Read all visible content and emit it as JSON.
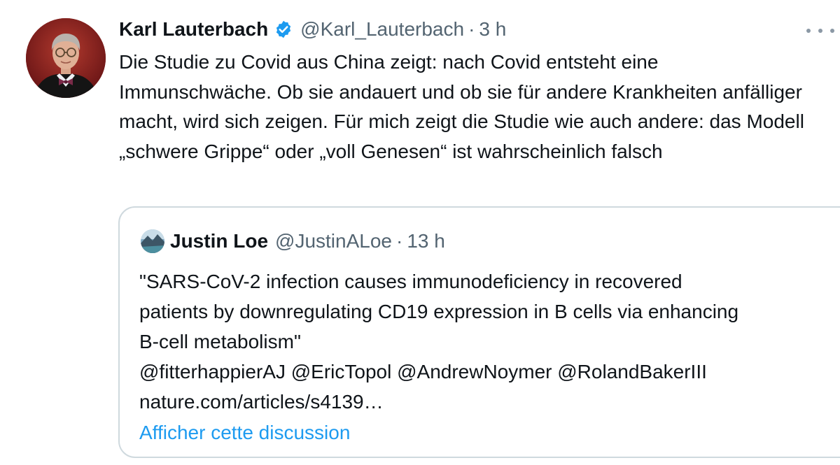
{
  "tweet": {
    "display_name": "Karl Lauterbach",
    "handle": "@Karl_Lauterbach",
    "separator": "·",
    "time": "3 h",
    "text": "Die Studie zu Covid aus China zeigt: nach Covid entsteht eine Immunschwäche. Ob sie andauert und ob sie für andere Krankheiten anfälliger macht, wird sich zeigen. Für mich zeigt die Studie wie auch andere: das Modell „schwere Grippe“ oder „voll Genesen“ ist wahrscheinlich falsch",
    "verified_icon": "verified-badge-icon",
    "more_icon": "more-options-icon",
    "colors": {
      "verified": "#1d9bf0",
      "secondary_text": "#536471",
      "link": "#1d9bf0",
      "border": "#cfd9de"
    }
  },
  "quoted_tweet": {
    "display_name": "Justin Loe",
    "handle": "@JustinALoe",
    "separator": "·",
    "time": "13 h",
    "text_lines": [
      "\"SARS-CoV-2 infection causes immunodeficiency in recovered",
      "patients by downregulating CD19 expression in B cells via enhancing",
      "B-cell metabolism\""
    ],
    "mentions": "@fitterhappierAJ @EricTopol @AndrewNoymer @RolandBakerIII",
    "link": "nature.com/articles/s4139…",
    "show_thread": "Afficher cette discussion"
  }
}
